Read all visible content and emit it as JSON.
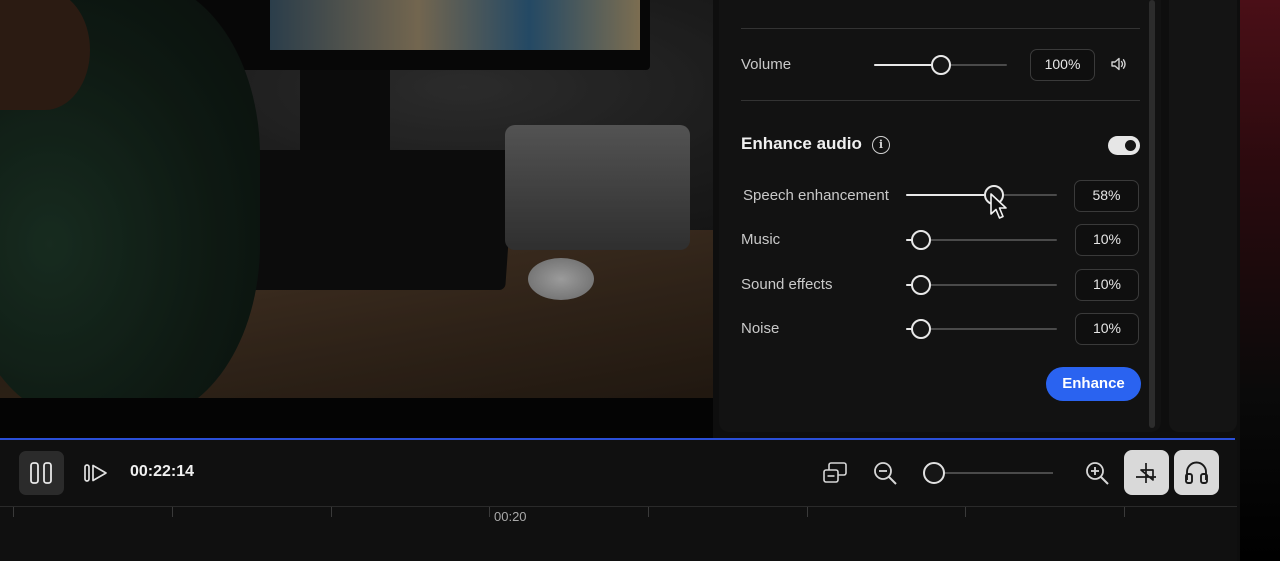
{
  "audio_panel": {
    "volume": {
      "label": "Volume",
      "value_text": "100%",
      "level": 0.5
    },
    "enhance": {
      "title": "Enhance audio",
      "enabled": true,
      "sliders": [
        {
          "label": "Speech enhancement",
          "value_text": "58%",
          "level": 0.58
        },
        {
          "label": "Music",
          "value_text": "10%",
          "level": 0.1
        },
        {
          "label": "Sound effects",
          "value_text": "10%",
          "level": 0.1
        },
        {
          "label": "Noise",
          "value_text": "10%",
          "level": 0.1
        }
      ],
      "button_label": "Enhance"
    }
  },
  "player": {
    "current_time": "00:22:14",
    "zoom_level": 0
  },
  "timeline": {
    "ruler_label": "00:20"
  },
  "colors": {
    "accent": "#2a63f0",
    "playhead_line": "#2a4fd8"
  },
  "icons": [
    "info-icon",
    "speaker-icon",
    "pause-icon",
    "play-next-icon",
    "captions-icon",
    "zoom-out-icon",
    "zoom-in-icon",
    "scene-edit-icon",
    "headphones-icon",
    "mouse-cursor-icon"
  ]
}
